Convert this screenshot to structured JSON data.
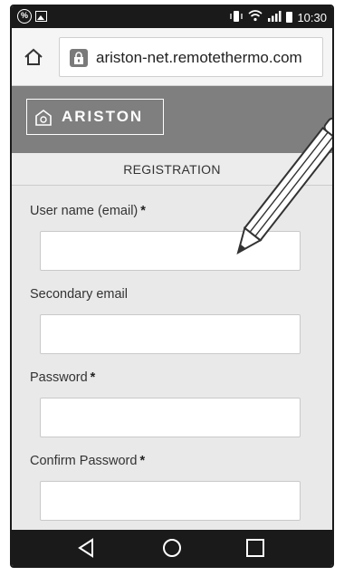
{
  "status_bar": {
    "time": "10:30",
    "left_icons": [
      "percent-icon",
      "image-icon"
    ],
    "right_icons": [
      "vibrate-icon",
      "wifi-icon",
      "signal-icon",
      "battery-icon"
    ]
  },
  "browser": {
    "url": "ariston-net.remotethermo.com",
    "home_icon": "home-icon",
    "lock_icon": "lock-icon"
  },
  "header": {
    "logo_text": "ARISTON",
    "background": "#7f7f7f"
  },
  "registration": {
    "title": "REGISTRATION"
  },
  "form": {
    "fields": [
      {
        "label": "User name (email)",
        "required": "*",
        "value": ""
      },
      {
        "label": "Secondary email",
        "required": "",
        "value": ""
      },
      {
        "label": "Password",
        "required": "*",
        "value": ""
      },
      {
        "label": "Confirm Password",
        "required": "*",
        "value": ""
      }
    ]
  },
  "nav": {
    "icons": [
      "back-icon",
      "home-circle-icon",
      "recents-icon"
    ]
  }
}
